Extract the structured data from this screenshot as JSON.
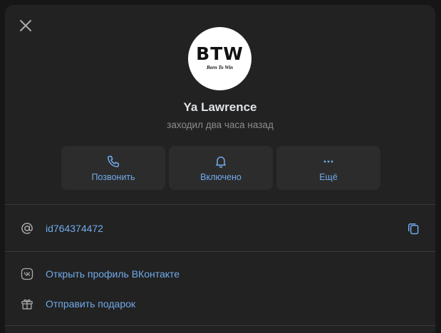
{
  "profile": {
    "avatar_text": "BTW",
    "avatar_subtext": "Born To Win",
    "name": "Ya Lawrence",
    "last_seen": "заходил два часа назад"
  },
  "actions": [
    {
      "label": "Позвонить",
      "icon": "phone-icon"
    },
    {
      "label": "Включено",
      "icon": "bell-icon"
    },
    {
      "label": "Ещё",
      "icon": "more-icon"
    }
  ],
  "info": {
    "user_id": "id764374472",
    "id_icon": "at-icon",
    "copy_icon": "copy-icon"
  },
  "links": [
    {
      "label": "Открыть профиль ВКонтакте",
      "icon": "vk-icon"
    },
    {
      "label": "Отправить подарок",
      "icon": "gift-icon"
    }
  ],
  "colors": {
    "accent": "#71aaeb",
    "background": "#222222",
    "button": "#2c2c2c"
  }
}
